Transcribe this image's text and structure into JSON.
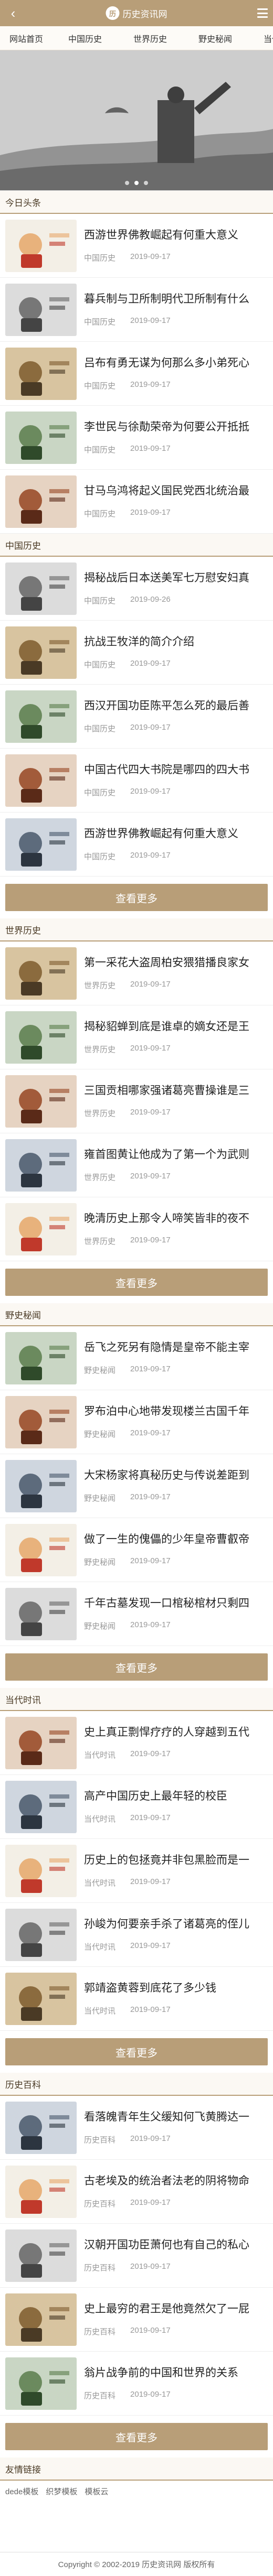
{
  "header": {
    "logo_mark": "历",
    "logo_text": "历史资讯网"
  },
  "nav": [
    "网站首页",
    "中国历史",
    "世界历史",
    "野史秘闻",
    "当代时讯"
  ],
  "sections": [
    {
      "title": "今日头条",
      "more": "",
      "items": [
        {
          "title": "西游世界佛教崛起有何重大意义",
          "category": "中国历史",
          "date": "2019-09-17"
        },
        {
          "title": "暮兵制与卫所制明代卫所制有什么",
          "category": "中国历史",
          "date": "2019-09-17"
        },
        {
          "title": "吕布有勇无谋为何那么多小弟死心",
          "category": "中国历史",
          "date": "2019-09-17"
        },
        {
          "title": "李世民与徐勣荣帝为何要公开抵抵",
          "category": "中国历史",
          "date": "2019-09-17"
        },
        {
          "title": "甘马乌鸿将起义国民党西北统治最",
          "category": "中国历史",
          "date": "2019-09-17"
        }
      ]
    },
    {
      "title": "中国历史",
      "more": "查看更多",
      "items": [
        {
          "title": "揭秘战后日本送美军七万慰安妇真",
          "category": "中国历史",
          "date": "2019-09-26"
        },
        {
          "title": "抗战王牧洋的简介介绍",
          "category": "中国历史",
          "date": "2019-09-17"
        },
        {
          "title": "西汉开国功臣陈平怎么死的最后善",
          "category": "中国历史",
          "date": "2019-09-17"
        },
        {
          "title": "中国古代四大书院是哪四的四大书",
          "category": "中国历史",
          "date": "2019-09-17"
        },
        {
          "title": "西游世界佛教崛起有何重大意义",
          "category": "中国历史",
          "date": "2019-09-17"
        }
      ]
    },
    {
      "title": "世界历史",
      "more": "查看更多",
      "items": [
        {
          "title": "第一采花大盗周柏安猥猎播良家女",
          "category": "世界历史",
          "date": "2019-09-17"
        },
        {
          "title": "揭秘貂蝉到底是谁卓的嫡女还是王",
          "category": "世界历史",
          "date": "2019-09-17"
        },
        {
          "title": "三国贡相哪家强诸葛亮曹操谁是三",
          "category": "世界历史",
          "date": "2019-09-17"
        },
        {
          "title": "雍首图黄让他成为了第一个为武则",
          "category": "世界历史",
          "date": "2019-09-17"
        },
        {
          "title": "晚清历史上那令人啼笑皆非的夜不",
          "category": "世界历史",
          "date": "2019-09-17"
        }
      ]
    },
    {
      "title": "野史秘闻",
      "more": "查看更多",
      "items": [
        {
          "title": "岳飞之死另有隐情是皇帝不能主宰",
          "category": "野史秘闻",
          "date": "2019-09-17"
        },
        {
          "title": "罗布泊中心地带发现楼兰古国千年",
          "category": "野史秘闻",
          "date": "2019-09-17"
        },
        {
          "title": "大宋杨家将真秘历史与传说差距到",
          "category": "野史秘闻",
          "date": "2019-09-17"
        },
        {
          "title": "做了一生的傀儡的少年皇帝曹叡帝",
          "category": "野史秘闻",
          "date": "2019-09-17"
        },
        {
          "title": "千年古墓发现一口棺秘棺材只剩四",
          "category": "野史秘闻",
          "date": "2019-09-17"
        }
      ]
    },
    {
      "title": "当代时讯",
      "more": "查看更多",
      "items": [
        {
          "title": "史上真正剽悍疗疗的人穿越到五代",
          "category": "当代时讯",
          "date": "2019-09-17"
        },
        {
          "title": "高产中国历史上最年轻的校臣",
          "category": "当代时讯",
          "date": "2019-09-17"
        },
        {
          "title": "历史上的包拯竟并非包黑脸而是一",
          "category": "当代时讯",
          "date": "2019-09-17"
        },
        {
          "title": "孙峻为何要亲手杀了诸葛亮的侄儿",
          "category": "当代时讯",
          "date": "2019-09-17"
        },
        {
          "title": "郭靖盗黄蓉到底花了多少钱",
          "category": "当代时讯",
          "date": "2019-09-17"
        }
      ]
    },
    {
      "title": "历史百科",
      "more": "查看更多",
      "items": [
        {
          "title": "看落魄青年生父缓知何飞黄腾达一",
          "category": "历史百科",
          "date": "2019-09-17"
        },
        {
          "title": "古老埃及的统治者法老的阴将物命",
          "category": "历史百科",
          "date": "2019-09-17"
        },
        {
          "title": "汉朝开国功臣萧何也有自己的私心",
          "category": "历史百科",
          "date": "2019-09-17"
        },
        {
          "title": "史上最穷的君王是他竟然欠了一屁",
          "category": "历史百科",
          "date": "2019-09-17"
        },
        {
          "title": "翁片战争前的中国和世界的关系",
          "category": "历史百科",
          "date": "2019-09-17"
        }
      ]
    }
  ],
  "links": {
    "title": "友情链接",
    "items": [
      "dede模板",
      "织梦模板",
      "模板云"
    ]
  },
  "footer": {
    "copyright": "Copyright © 2002-2019 历史资讯网 版权所有"
  },
  "colors": {
    "accent": "#b89e78",
    "accent_dark": "#4a3a25",
    "text": "#222222",
    "muted": "#999999"
  }
}
